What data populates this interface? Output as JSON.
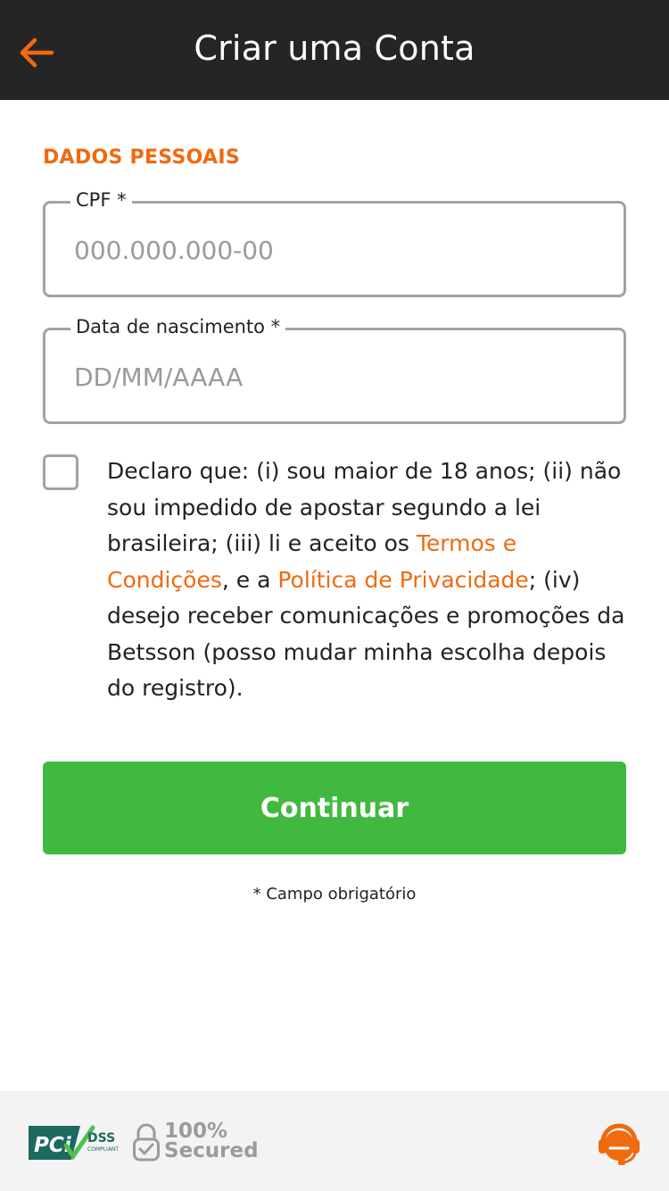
{
  "header": {
    "title": "Criar uma Conta",
    "back_icon": "arrow-left-icon",
    "accent": "#f06a0f"
  },
  "section": {
    "title": "DADOS PESSOAIS"
  },
  "fields": {
    "cpf": {
      "label": "CPF *",
      "placeholder": "000.000.000-00",
      "value": ""
    },
    "birth": {
      "label": "Data de nascimento *",
      "placeholder": "DD/MM/AAAA",
      "value": ""
    }
  },
  "declaration": {
    "checked": false,
    "text_1": "Declaro que: (i) sou maior de 18 anos; (ii) não sou impedido de apostar segundo a lei brasileira; (iii) li e aceito os ",
    "link_terms": "Termos e Condições",
    "text_2": ", e a ",
    "link_privacy": "Política de Privacidade",
    "text_3": "; (iv) desejo receber comunicações e promoções da Betsson (posso mudar minha escolha depois do registro)."
  },
  "actions": {
    "continue_label": "Continuar",
    "continue_color": "#41b941"
  },
  "required_note": "* Campo obrigatório",
  "footer": {
    "pci_text": "PCi",
    "dss_text": "DSS",
    "compliant_text": "COMPLIANT",
    "secured_line1": "100%",
    "secured_line2": "Secured",
    "support_icon": "headset-icon"
  }
}
